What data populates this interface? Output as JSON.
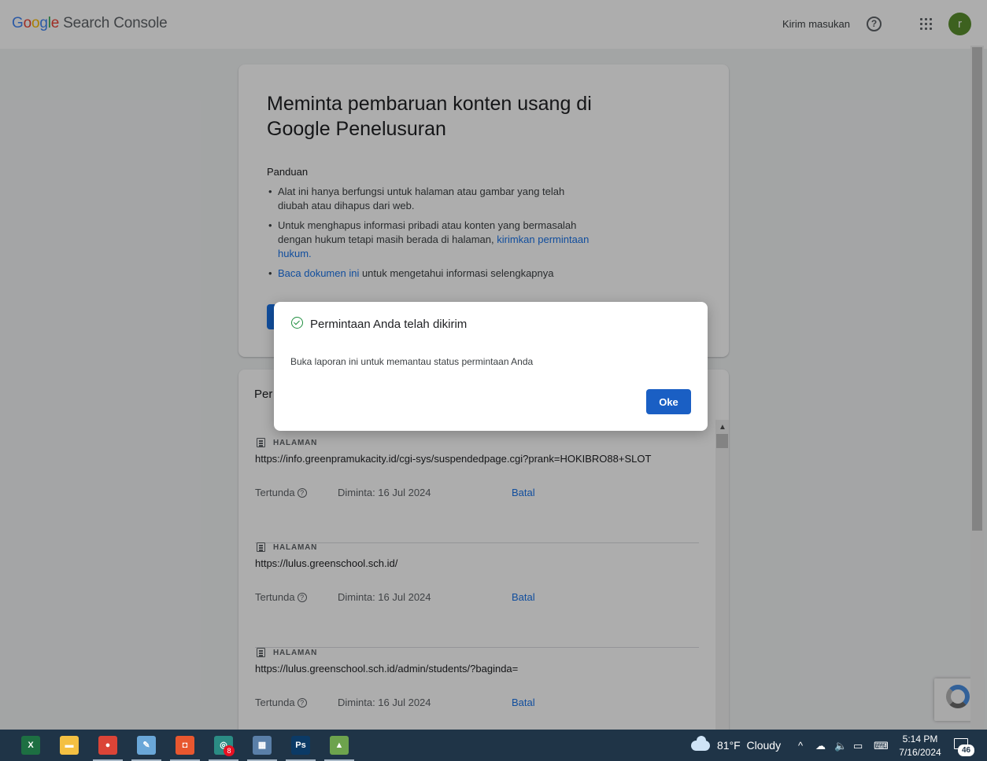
{
  "header": {
    "product_name": "Search Console",
    "feedback_label": "Kirim masukan",
    "help_icon": "help-circle-icon",
    "apps_icon": "apps-grid-icon",
    "avatar_letter": "r",
    "avatar_color": "#5b8f2e"
  },
  "main_card": {
    "title": "Meminta pembaruan konten usang di Google Penelusuran",
    "guide_title": "Panduan",
    "guide_items": [
      {
        "text": "Alat ini hanya berfungsi untuk halaman atau gambar yang telah diubah atau dihapus dari web."
      },
      {
        "text_before": "Untuk menghapus informasi pribadi atau konten yang bermasalah dengan hukum tetapi masih berada di halaman, ",
        "link": "kirimkan permintaan hukum."
      },
      {
        "link": "Baca dokumen ini",
        "text_after": " untuk mengetahui informasi selengkapnya"
      }
    ]
  },
  "requests": {
    "heading": "Per",
    "items": [
      {
        "type": "HALAMAN",
        "url": "https://info.greenpramukacity.id/cgi-sys/suspendedpage.cgi?prank=HOKIBRO88+SLOT",
        "status": "Tertunda",
        "date": "Diminta: 16 Jul 2024",
        "action": "Batal"
      },
      {
        "type": "HALAMAN",
        "url": "https://lulus.greenschool.sch.id/",
        "status": "Tertunda",
        "date": "Diminta: 16 Jul 2024",
        "action": "Batal"
      },
      {
        "type": "HALAMAN",
        "url": "https://lulus.greenschool.sch.id/admin/students/?baginda=",
        "status": "Tertunda",
        "date": "Diminta: 16 Jul 2024",
        "action": "Batal"
      }
    ]
  },
  "dialog": {
    "title": "Permintaan Anda telah dikirim",
    "body": "Buka laporan ini untuk memantau status permintaan Anda",
    "ok_label": "Oke",
    "icon": "check-circle-icon",
    "accent_color": "#1a5fc4"
  },
  "taskbar": {
    "apps": [
      {
        "name": "excel",
        "glyph": "X",
        "color": "#1d6f42"
      },
      {
        "name": "file-explorer",
        "glyph": "▬",
        "color": "#f4c042"
      },
      {
        "name": "chrome",
        "glyph": "●",
        "color": "#db4437"
      },
      {
        "name": "notepad",
        "glyph": "✎",
        "color": "#6aa7d8"
      },
      {
        "name": "chat",
        "glyph": "◘",
        "color": "#e8572f"
      },
      {
        "name": "headset-app",
        "glyph": "◎",
        "color": "#2b8c84"
      },
      {
        "name": "calculator",
        "glyph": "▦",
        "color": "#5a7fa8"
      },
      {
        "name": "photoshop",
        "glyph": "Ps",
        "color": "#0b3a66"
      },
      {
        "name": "chart-app",
        "glyph": "▲",
        "color": "#6da34d"
      }
    ],
    "badge_count": "8",
    "weather_temp": "81°F",
    "weather_text": "Cloudy",
    "time": "5:14 PM",
    "date": "7/16/2024",
    "notification_count": "46"
  }
}
